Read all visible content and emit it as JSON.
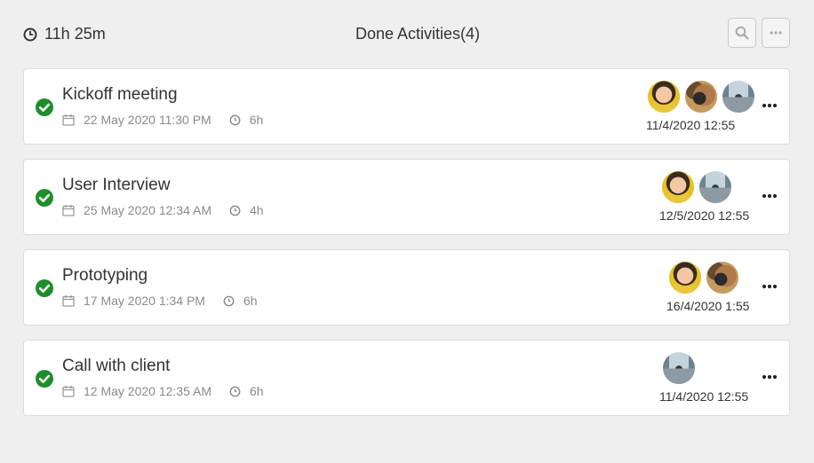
{
  "header": {
    "total_time": "11h 25m",
    "title": "Done Activities(4)",
    "search_icon": "search-icon",
    "more_icon": "more-dots-icon"
  },
  "activities": [
    {
      "title": "Kickoff meeting",
      "date": "22 May 2020 11:30 PM",
      "duration": "6h",
      "updated": "11/4/2020 12:55",
      "avatars": [
        "woman",
        "camera",
        "street"
      ]
    },
    {
      "title": "User Interview",
      "date": "25 May 2020 12:34 AM",
      "duration": "4h",
      "updated": "12/5/2020 12:55",
      "avatars": [
        "woman",
        "street"
      ]
    },
    {
      "title": "Prototyping",
      "date": "17 May 2020 1:34 PM",
      "duration": "6h",
      "updated": "16/4/2020 1:55",
      "avatars": [
        "woman",
        "camera"
      ]
    },
    {
      "title": "Call with client",
      "date": "12 May 2020 12:35 AM",
      "duration": "6h",
      "updated": "11/4/2020 12:55",
      "avatars": [
        "street"
      ]
    }
  ],
  "colors": {
    "check": "#1e8e2a",
    "background": "#efefef",
    "card": "#ffffff"
  }
}
